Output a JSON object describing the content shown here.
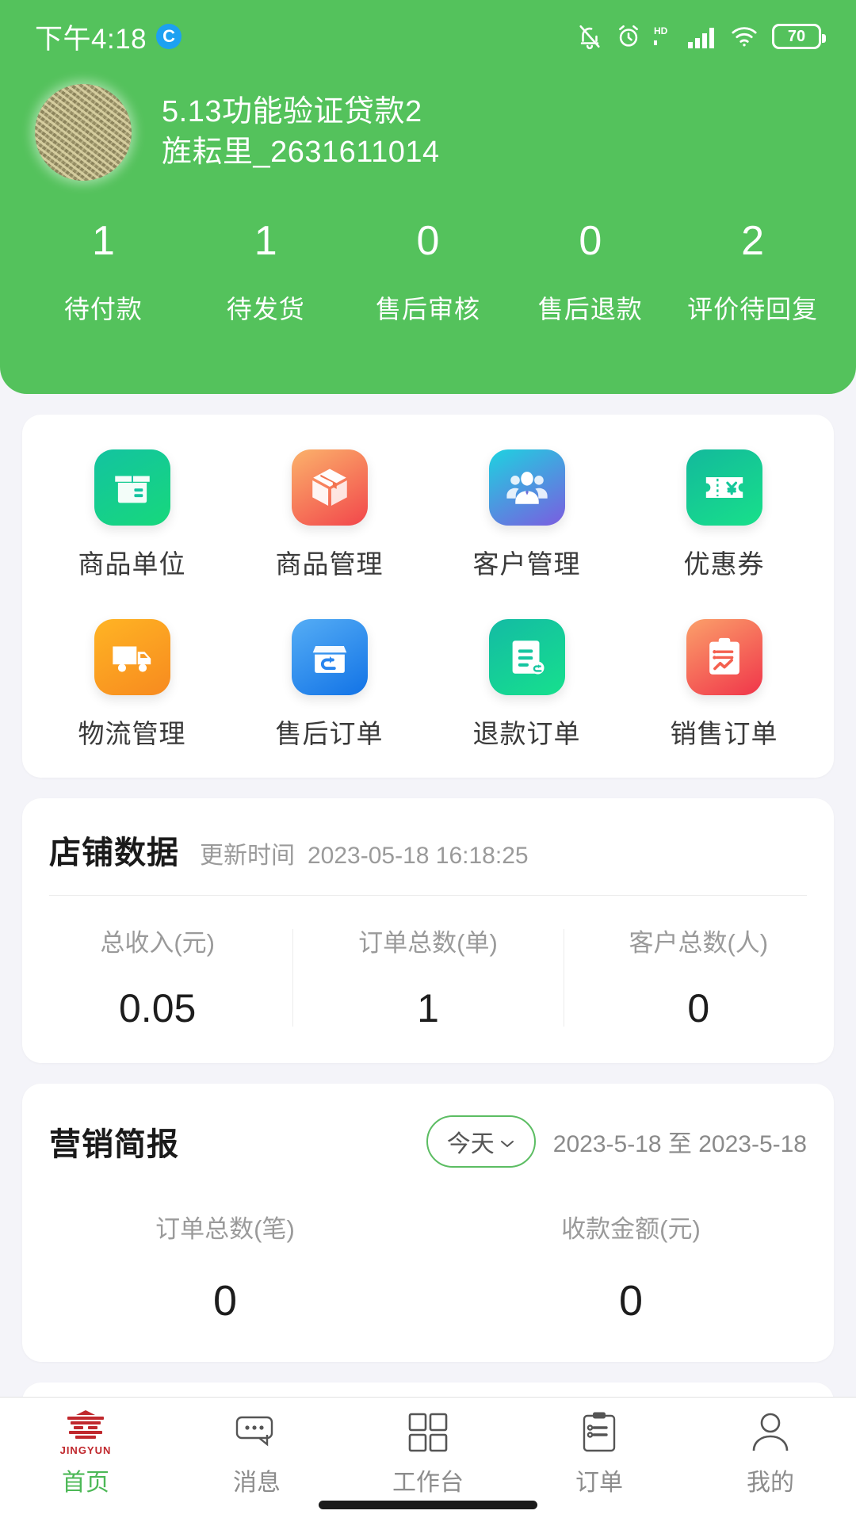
{
  "status_bar": {
    "time": "下午4:18",
    "app_badge": "C",
    "icons": [
      "bell-mute-icon",
      "alarm-clock-icon",
      "hd-icon",
      "signal-bars-icon",
      "wifi-icon",
      "battery-icon"
    ],
    "battery_level": "70"
  },
  "header": {
    "background_color": "#54c25c",
    "avatar_alt": "shop-avatar",
    "shop_name": "5.13功能验证贷款2",
    "shop_id": "旌耘里_2631611014",
    "stats": [
      {
        "value": "1",
        "label": "待付款"
      },
      {
        "value": "1",
        "label": "待发货"
      },
      {
        "value": "0",
        "label": "售后审核"
      },
      {
        "value": "0",
        "label": "售后退款"
      },
      {
        "value": "2",
        "label": "评价待回复"
      }
    ]
  },
  "menu": {
    "row1": [
      {
        "label": "商品单位",
        "icon": "product-unit-icon",
        "c1": "#13c3a0",
        "c2": "#17d87c"
      },
      {
        "label": "商品管理",
        "icon": "product-box-icon",
        "c1": "#fbb26b",
        "c2": "#f2464b"
      },
      {
        "label": "客户管理",
        "icon": "customers-icon",
        "c1": "#1ed2e0",
        "c2": "#7b5ce0"
      },
      {
        "label": "优惠券",
        "icon": "coupon-icon",
        "c1": "#13b99c",
        "c2": "#18e08a"
      }
    ],
    "row2": [
      {
        "label": "物流管理",
        "icon": "truck-icon",
        "c1": "#ffb424",
        "c2": "#f78a1f"
      },
      {
        "label": "售后订单",
        "icon": "return-box-icon",
        "c1": "#55adf5",
        "c2": "#1273e6"
      },
      {
        "label": "退款订单",
        "icon": "refund-doc-icon",
        "c1": "#14bba4",
        "c2": "#16e08d"
      },
      {
        "label": "销售订单",
        "icon": "sales-report-icon",
        "c1": "#fba06a",
        "c2": "#f0354a"
      }
    ]
  },
  "shop_data": {
    "title": "店铺数据",
    "updated_label": "更新时间",
    "updated_time": "2023-05-18 16:18:25",
    "metrics": [
      {
        "label": "总收入(元)",
        "value": "0.05"
      },
      {
        "label": "订单总数(单)",
        "value": "1"
      },
      {
        "label": "客户总数(人)",
        "value": "0"
      }
    ]
  },
  "marketing": {
    "title": "营销简报",
    "period_label": "今天",
    "period_caret": "⌄",
    "date_range": "2023-5-18 至 2023-5-18",
    "metrics": [
      {
        "label": "订单总数(笔)",
        "value": "0"
      },
      {
        "label": "收款金额(元)",
        "value": "0"
      }
    ]
  },
  "tabbar": {
    "active_color": "#4cb856",
    "items": [
      {
        "label": "首页",
        "icon": "jingyun-logo-icon",
        "logo_text": "JINGYUN",
        "active": true
      },
      {
        "label": "消息",
        "icon": "message-bubble-icon",
        "active": false
      },
      {
        "label": "工作台",
        "icon": "workbench-grid-icon",
        "active": false
      },
      {
        "label": "订单",
        "icon": "order-clipboard-icon",
        "active": false
      },
      {
        "label": "我的",
        "icon": "profile-person-icon",
        "active": false
      }
    ]
  }
}
